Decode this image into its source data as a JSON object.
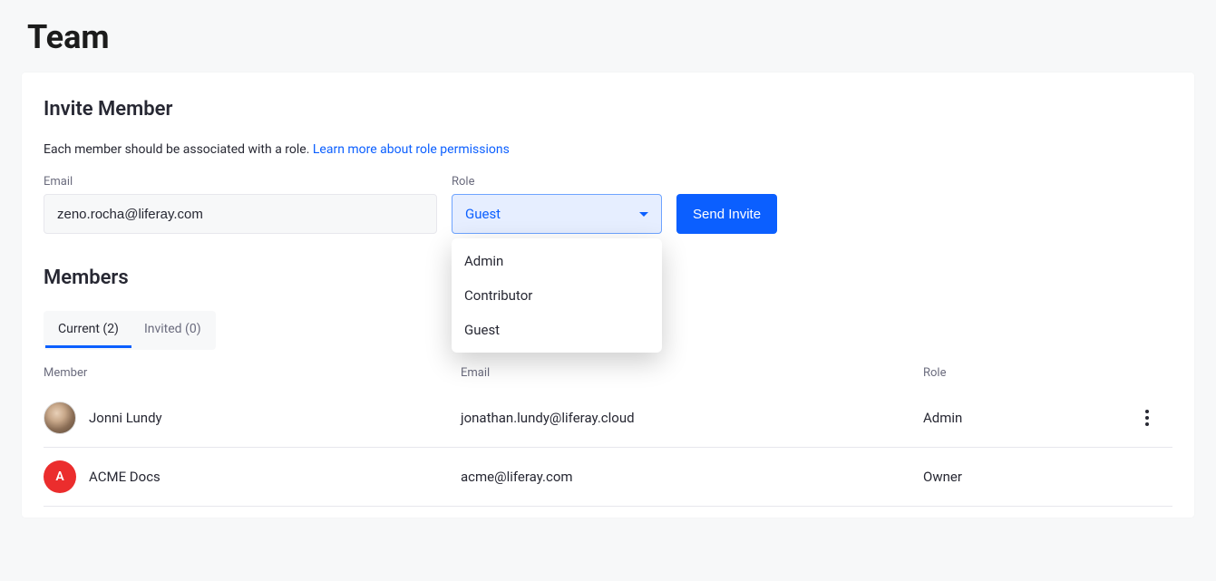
{
  "page": {
    "title": "Team"
  },
  "invite": {
    "title": "Invite Member",
    "help_text": "Each member should be associated with a role. ",
    "help_link": "Learn more about role permissions",
    "email_label": "Email",
    "email_value": "zeno.rocha@liferay.com",
    "role_label": "Role",
    "role_selected": "Guest",
    "role_options": [
      "Admin",
      "Contributor",
      "Guest"
    ],
    "send_button": "Send Invite"
  },
  "members": {
    "title": "Members",
    "tabs": [
      {
        "label": "Current (2)",
        "active": true
      },
      {
        "label": "Invited (0)",
        "active": false
      }
    ],
    "columns": {
      "member": "Member",
      "email": "Email",
      "role": "Role"
    },
    "rows": [
      {
        "avatar_type": "image",
        "avatar_letter": "",
        "name": "Jonni Lundy",
        "email": "jonathan.lundy@liferay.cloud",
        "role": "Admin",
        "actions": true
      },
      {
        "avatar_type": "letter",
        "avatar_letter": "A",
        "name": "ACME Docs",
        "email": "acme@liferay.com",
        "role": "Owner",
        "actions": false
      }
    ]
  }
}
